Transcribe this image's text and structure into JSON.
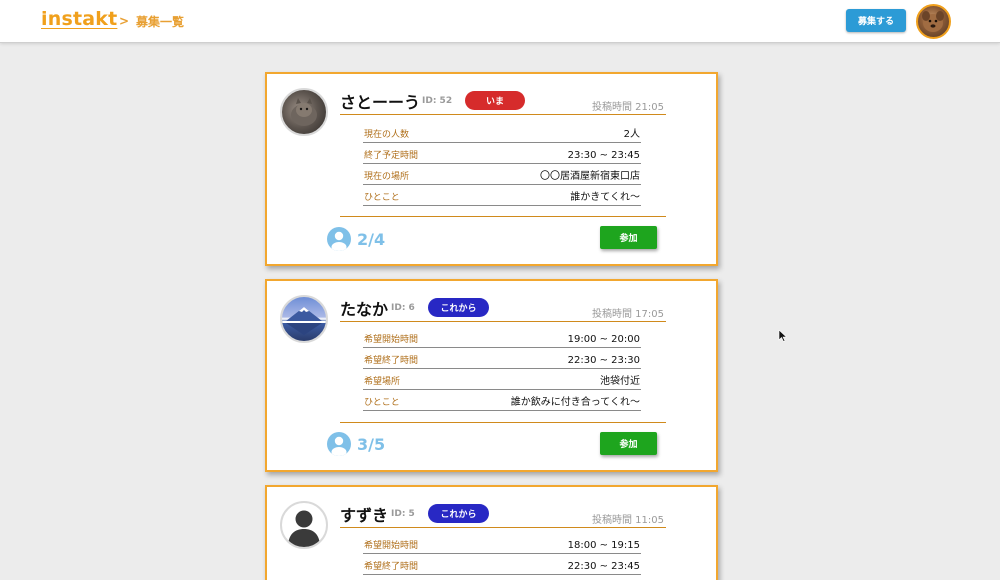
{
  "header": {
    "logo": "instakt",
    "breadcrumb_sep": ">",
    "breadcrumb_page": "募集一覧",
    "recruit_button": "募集する"
  },
  "colors": {
    "accent": "#f0a01c",
    "now_badge": "#d62b2b",
    "upcoming_badge": "#2828c4",
    "join_button": "#1ea51e",
    "participants": "#7fc0e8"
  },
  "posts": [
    {
      "name": "さとーーう",
      "id": "ID: 52",
      "status": "いま",
      "posted": "投稿時間 21:05",
      "rows": [
        {
          "label": "現在の人数",
          "value": "2人"
        },
        {
          "label": "終了予定時間",
          "value": "23:30 ~ 23:45"
        },
        {
          "label": "現在の場所",
          "value": "〇〇居酒屋新宿東口店"
        },
        {
          "label": "ひとこと",
          "value": "誰かきてくれ〜"
        }
      ],
      "participants": "2/4",
      "join": "参加"
    },
    {
      "name": "たなか",
      "id": "ID: 6",
      "status": "これから",
      "posted": "投稿時間 17:05",
      "rows": [
        {
          "label": "希望開始時間",
          "value": "19:00 ~ 20:00"
        },
        {
          "label": "希望終了時間",
          "value": "22:30 ~ 23:30"
        },
        {
          "label": "希望場所",
          "value": "池袋付近"
        },
        {
          "label": "ひとこと",
          "value": "誰か飲みに付き合ってくれ〜"
        }
      ],
      "participants": "3/5",
      "join": "参加"
    },
    {
      "name": "すずき",
      "id": "ID: 5",
      "status": "これから",
      "posted": "投稿時間 11:05",
      "rows": [
        {
          "label": "希望開始時間",
          "value": "18:00 ~ 19:15"
        },
        {
          "label": "希望終了時間",
          "value": "22:30 ~ 23:45"
        }
      ]
    }
  ]
}
